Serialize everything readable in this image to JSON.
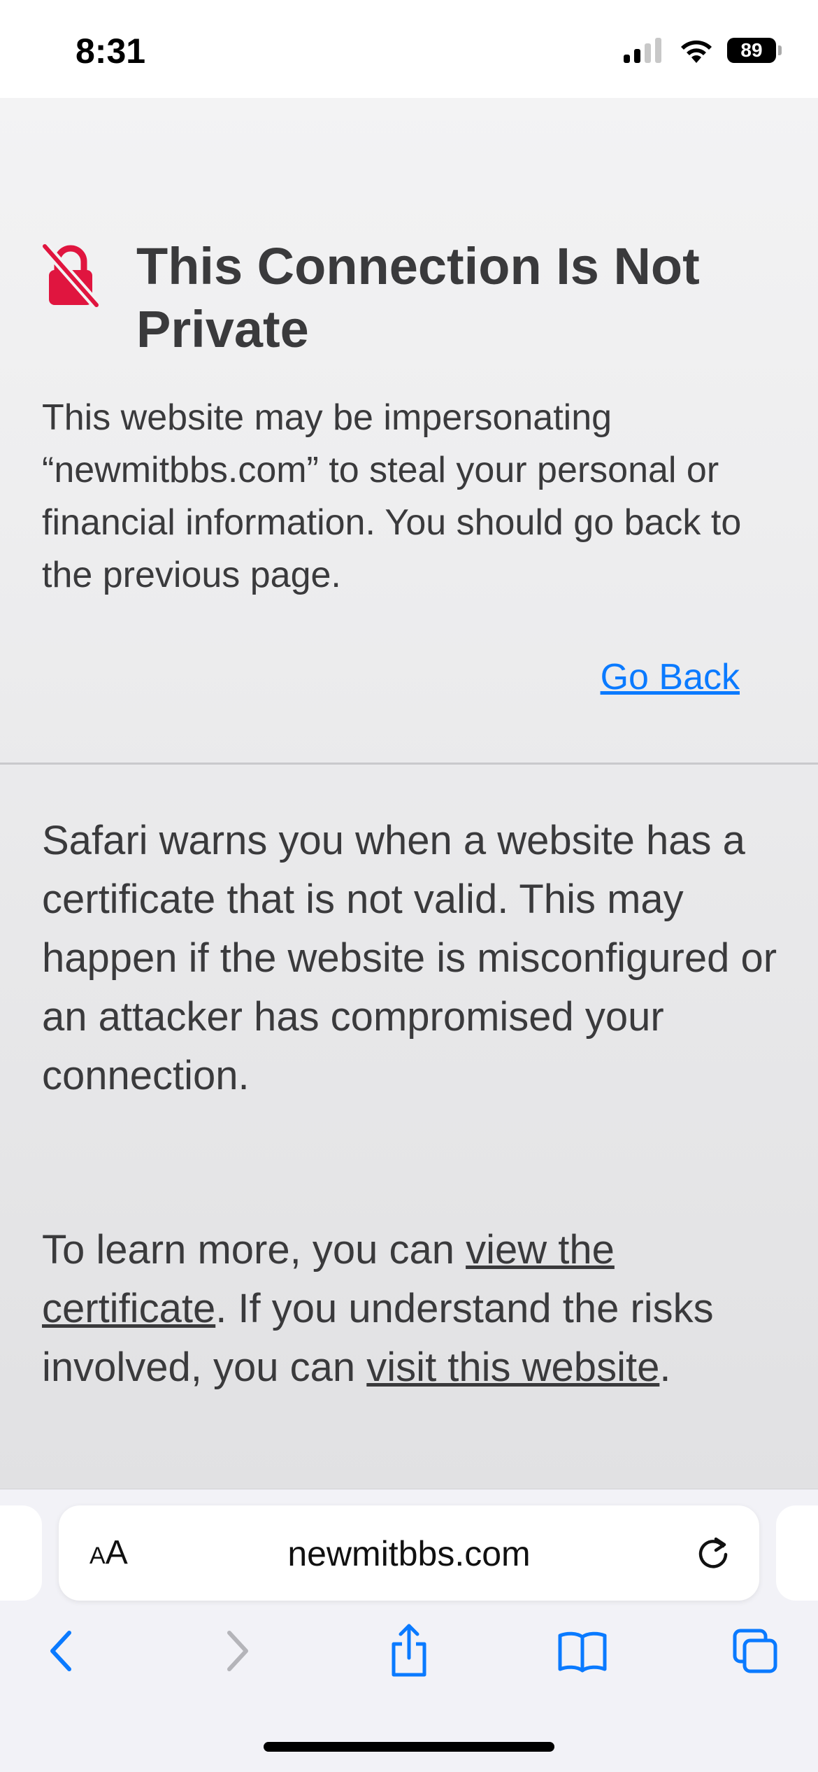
{
  "status_bar": {
    "time": "8:31",
    "battery_level": "89",
    "signal_bars_active": 2,
    "signal_bars_total": 4
  },
  "warning": {
    "icon": "lock-slash-icon",
    "icon_color": "#e0153f",
    "title": "This Connection Is Not Private",
    "body": "This website may be impersonating “newmitbbs.com” to steal your personal or financial information. You should go back to the previous page.",
    "go_back_label": "Go Back",
    "explanation": "Safari warns you when a website has a certificate that is not valid. This may happen if the website is misconfigured or an attacker has compromised your connection.",
    "learn_more_prefix": "To learn more, you can ",
    "view_certificate_label": "view the certificate",
    "learn_more_middle": ". If you understand the risks involved, you can ",
    "visit_website_label": "visit this website",
    "learn_more_suffix": "."
  },
  "address_bar": {
    "aa_small": "A",
    "aa_large": "A",
    "url": "newmitbbs.com"
  },
  "toolbar": {
    "back_icon": "chevron-left-icon",
    "forward_icon": "chevron-right-icon",
    "share_icon": "share-icon",
    "bookmarks_icon": "book-icon",
    "tabs_icon": "tabs-icon",
    "accent_color": "#0a7aff"
  }
}
